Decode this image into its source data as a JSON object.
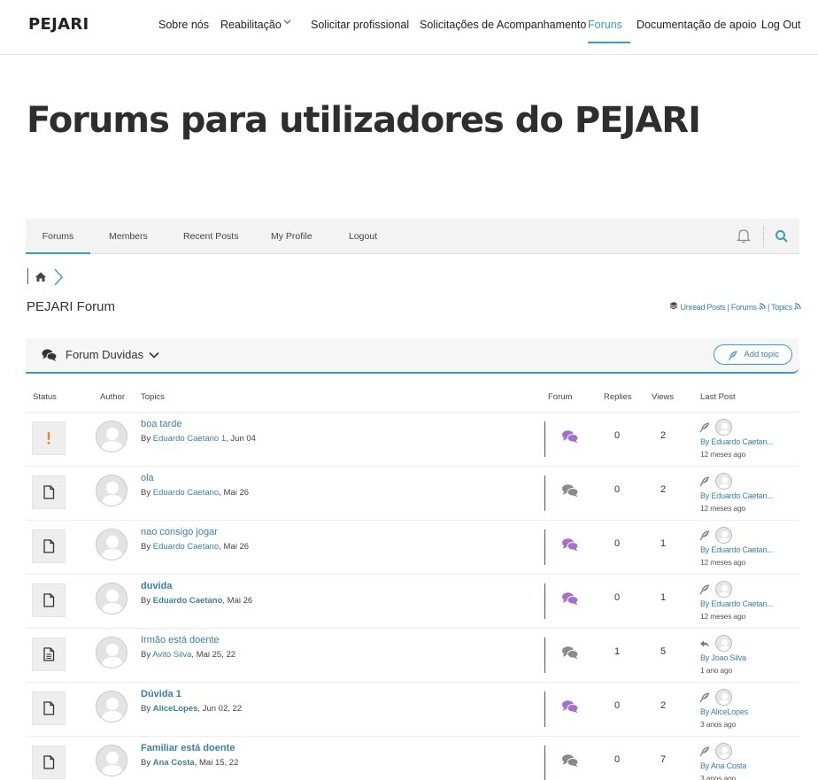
{
  "header": {
    "logo": "PEJARI",
    "nav": [
      {
        "label": "Sobre nós"
      },
      {
        "label": "Reabilitação"
      },
      {
        "label": "Solicitar profissional"
      },
      {
        "label": "Solicitações de Acompanhamento"
      },
      {
        "label": "Foruns"
      },
      {
        "label": "Documentação de apoio"
      },
      {
        "label": "Log Out"
      }
    ],
    "active_nav": "Foruns"
  },
  "page_title": "Forums para utilizadores do PEJARI",
  "forum_tabs": [
    "Forums",
    "Members",
    "Recent Posts",
    "My Profile",
    "Logout"
  ],
  "forum_name": "PEJARI Forum",
  "quick_links": {
    "unread": "Unread Posts",
    "sep": " | ",
    "forums": "Forums",
    "topics": "Topics"
  },
  "forum_header": {
    "title": "Forum Duvidas",
    "add_topic": "Add topic"
  },
  "columns": {
    "status": "Status",
    "author": "Author",
    "topics": "Topics",
    "forum": "Forum",
    "replies": "Replies",
    "views": "Views",
    "last_post": "Last Post"
  },
  "topics": [
    {
      "status": "alert-icon",
      "title": "boa tarde",
      "bold": false,
      "by": "By ",
      "author": "Eduardo Caetano 1",
      "date": ", Jun 04",
      "forum_icon_color": "#a371c9",
      "replies": "0",
      "views": "2",
      "last_icon": "feather-icon",
      "last_by": "By Eduardo Caetan...",
      "last_time": "12 meses ago"
    },
    {
      "status": "file-icon",
      "title": "ola",
      "bold": false,
      "by": "By ",
      "author": "Eduardo Caetano",
      "date": ", Mai 26",
      "forum_icon_color": "#8a8a8a",
      "replies": "0",
      "views": "2",
      "last_icon": "feather-icon",
      "last_by": "By Eduardo Caetan...",
      "last_time": "12 meses ago"
    },
    {
      "status": "file-icon",
      "title": "nao consigo jogar",
      "bold": false,
      "by": "By ",
      "author": "Eduardo Caetano",
      "date": ", Mai 26",
      "forum_icon_color": "#a371c9",
      "replies": "0",
      "views": "1",
      "last_icon": "feather-icon",
      "last_by": "By Eduardo Caetan...",
      "last_time": "12 meses ago"
    },
    {
      "status": "file-icon",
      "title": "duvida",
      "bold": true,
      "by": "By ",
      "author": "Eduardo Caetano",
      "date": ", Mai 26",
      "forum_icon_color": "#a371c9",
      "replies": "0",
      "views": "1",
      "last_icon": "feather-icon",
      "last_by": "By Eduardo Caetan...",
      "last_time": "12 meses ago"
    },
    {
      "status": "file-text-icon",
      "title": "Irmão está doente",
      "bold": false,
      "by": "By ",
      "author": "Avito Silva",
      "date": ", Mai 25, 22",
      "forum_icon_color": "#8a8a8a",
      "replies": "1",
      "views": "5",
      "last_icon": "reply-icon",
      "last_by": "By Joao Silva",
      "last_time": "1 ano ago"
    },
    {
      "status": "file-icon",
      "title": "Dúvida 1",
      "bold": true,
      "by": "By ",
      "author": "AliceLopes",
      "date": ", Jun 02, 22",
      "forum_icon_color": "#a371c9",
      "replies": "0",
      "views": "2",
      "last_icon": "feather-icon",
      "last_by": "By AliceLopes",
      "last_time": "3 anos ago"
    },
    {
      "status": "file-icon",
      "title": "Familiar está doente",
      "bold": true,
      "by": "By ",
      "author": "Ana Costa",
      "date": ", Mai 15, 22",
      "forum_icon_color": "#8a8a8a",
      "replies": "0",
      "views": "7",
      "last_icon": "feather-icon",
      "last_by": "By Ana Costa",
      "last_time": "3 anos ago"
    }
  ],
  "colors": {
    "accent": "#3a9bc4",
    "link": "#3a7fa6",
    "alert": "#f0822a",
    "divider": "#8e3a6e"
  }
}
